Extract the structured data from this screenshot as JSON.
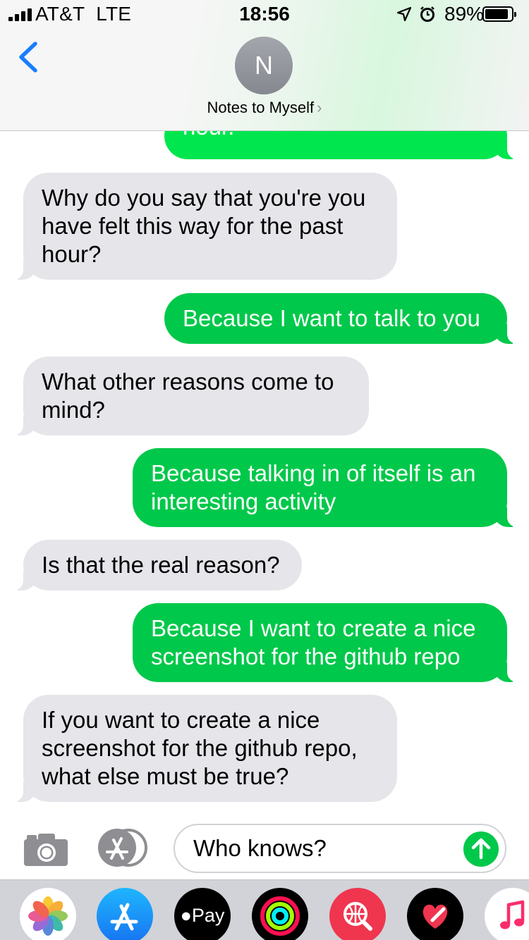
{
  "status_bar": {
    "carrier": "AT&T",
    "network": "LTE",
    "time": "18:56",
    "battery_percent": "89%",
    "battery_level": 0.89,
    "icons": [
      "signal-icon",
      "location-icon",
      "alarm-icon",
      "battery-icon"
    ]
  },
  "header": {
    "avatar_initial": "N",
    "contact_name": "Notes to Myself",
    "chevron": "›",
    "back_icon": "chevron-left-icon"
  },
  "messages": [
    {
      "direction": "out",
      "text": "hour.",
      "partial": true
    },
    {
      "direction": "in",
      "text": "Why do you say that you're you have felt this way for the past hour?"
    },
    {
      "direction": "out",
      "text": "Because I want to talk to you"
    },
    {
      "direction": "in",
      "text": "What other reasons come to mind?"
    },
    {
      "direction": "out",
      "text": "Because talking in of itself is an interesting activity"
    },
    {
      "direction": "in",
      "text": "Is that the real reason?"
    },
    {
      "direction": "out",
      "text": "Because I want to create a nice screenshot for the github repo"
    },
    {
      "direction": "in",
      "text": "If you want to create a nice screenshot for the github repo, what else must be true?"
    }
  ],
  "input": {
    "value": "Who knows?",
    "camera_icon": "camera-icon",
    "apps_icon": "app-store-icon",
    "send_icon": "send-arrow-icon"
  },
  "apps": {
    "items": [
      {
        "name": "photos",
        "icon": "photos-icon"
      },
      {
        "name": "app-store",
        "icon": "app-store-icon"
      },
      {
        "name": "apple-pay",
        "icon": "apple-pay-icon",
        "label": "Pay"
      },
      {
        "name": "activity",
        "icon": "activity-rings-icon"
      },
      {
        "name": "web-search",
        "icon": "globe-search-icon"
      },
      {
        "name": "digital-touch",
        "icon": "heart-touch-icon"
      },
      {
        "name": "music",
        "icon": "music-note-icon"
      }
    ]
  },
  "colors": {
    "outgoing_bubble": "#00c84a",
    "incoming_bubble": "#e5e5ea",
    "ios_blue": "#1a7cff"
  }
}
